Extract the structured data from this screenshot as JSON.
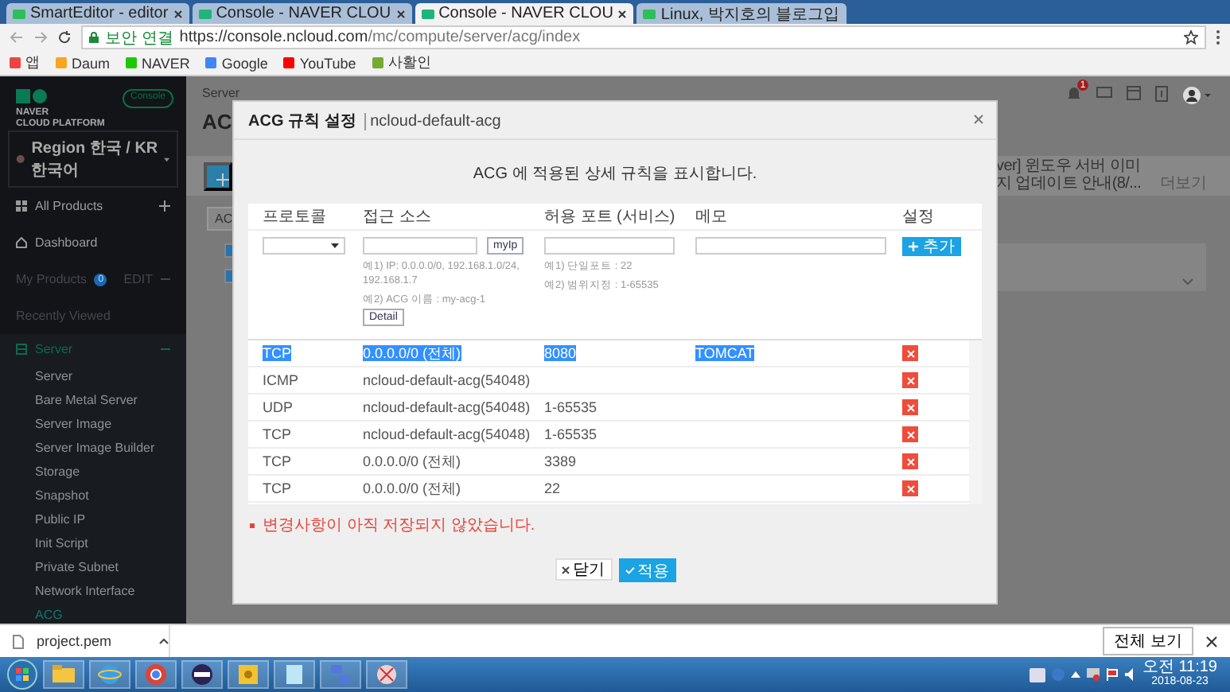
{
  "browser": {
    "tabs": [
      {
        "title": "SmartEditor - editor",
        "selected": false
      },
      {
        "title": "Console - NAVER CLOU",
        "selected": false
      },
      {
        "title": "Console - NAVER CLOU",
        "selected": true
      },
      {
        "title": "Linux, 박지호의 블로그입",
        "selected": false
      }
    ],
    "address": {
      "security_label": "보안 연결",
      "url_host": "https://console.ncloud.com",
      "url_path": "/mc/compute/server/acg/index"
    },
    "bookmarks": [
      "앱",
      "Daum",
      "NAVER",
      "Google",
      "YouTube",
      "사활인"
    ]
  },
  "sidebar": {
    "brand": "NAVER",
    "brand_sub": "CLOUD PLATFORM",
    "console_badge": "Console",
    "region": "Region 한국 / KR 한국어",
    "all_products": "All Products",
    "dashboard": "Dashboard",
    "my_products": "My Products",
    "my_products_count": "0",
    "edit": "EDIT",
    "recently_viewed": "Recently Viewed",
    "section": {
      "label": "Server",
      "expanded": true,
      "items": [
        {
          "label": "Server",
          "selected": false
        },
        {
          "label": "Bare Metal Server",
          "selected": false
        },
        {
          "label": "Server Image",
          "selected": false
        },
        {
          "label": "Server Image Builder",
          "selected": false
        },
        {
          "label": "Storage",
          "selected": false
        },
        {
          "label": "Snapshot",
          "selected": false
        },
        {
          "label": "Public IP",
          "selected": false
        },
        {
          "label": "Init Script",
          "selected": false
        },
        {
          "label": "Private Subnet",
          "selected": false
        },
        {
          "label": "Network Interface",
          "selected": false
        },
        {
          "label": "ACG",
          "selected": true
        }
      ]
    }
  },
  "background": {
    "breadcrumb": "Server",
    "title": "AC",
    "filter_button": "AC",
    "notification_count": "1",
    "notice": "ver] 윈도우 서버 이미지 업데이트 안내(8/...",
    "notice_more": "더보기",
    "rows": [
      {
        "checked": true
      },
      {
        "checked": true
      }
    ]
  },
  "modal": {
    "title": "ACG 규칙 설정",
    "subtitle": "ncloud-default-acg",
    "description": "ACG 에 적용된 상세 규칙을 표시합니다.",
    "columns": [
      "프로토콜",
      "접근 소스",
      "허용 포트 (서비스)",
      "메모",
      "설정"
    ],
    "form": {
      "my_ip_button": "myIp",
      "source_hints": [
        "예1) IP: 0.0.0.0/0, 192.168.1.0/24, 192.168.1.7",
        "예2) ACG 이름 : my-acg-1"
      ],
      "detail_button": "Detail",
      "port_hints": [
        "예1) 단일포트 : 22",
        "예2) 범위지정 : 1-65535"
      ],
      "add_button": "추가"
    },
    "rules": [
      {
        "protocol": "TCP",
        "source": "0.0.0.0/0 (전체)",
        "port": "8080",
        "memo": "TOMCAT",
        "selected": true
      },
      {
        "protocol": "ICMP",
        "source": "ncloud-default-acg(54048)",
        "selected": false
      },
      {
        "protocol": "UDP",
        "source": "ncloud-default-acg(54048)",
        "port": "1-65535",
        "selected": false
      },
      {
        "protocol": "TCP",
        "source": "ncloud-default-acg(54048)",
        "port": "1-65535",
        "selected": false
      },
      {
        "protocol": "TCP",
        "source": "0.0.0.0/0 (전체)",
        "port": "3389",
        "selected": false
      },
      {
        "protocol": "TCP",
        "source": "0.0.0.0/0 (전체)",
        "port": "22",
        "selected": false
      }
    ],
    "warning": "변경사항이 아직 저장되지 않았습니다.",
    "close_button": "닫기",
    "apply_button": "적용"
  },
  "downloads": {
    "file": "project.pem",
    "show_all": "전체 보기"
  },
  "taskbar": {
    "time": "오전 11:19",
    "date": "2018-08-23"
  }
}
